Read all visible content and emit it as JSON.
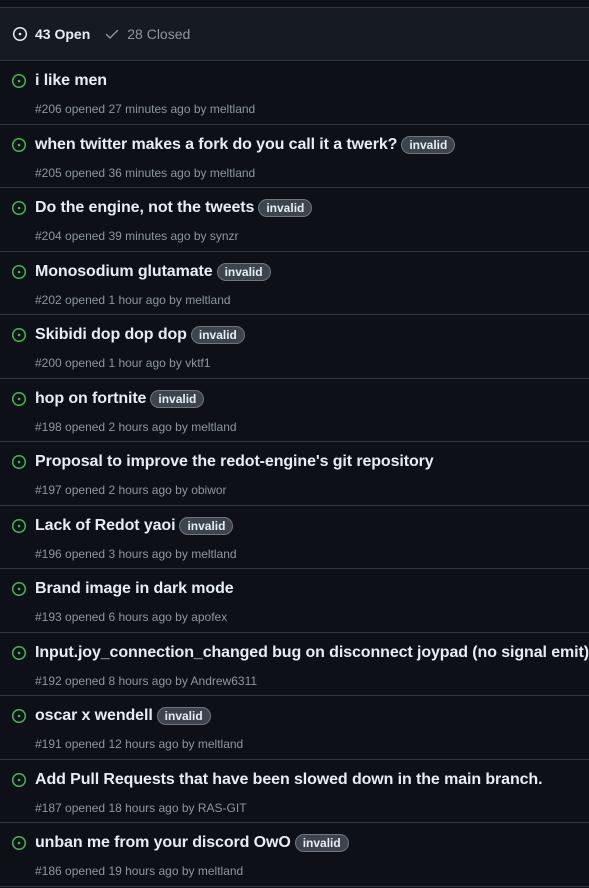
{
  "header": {
    "open_count_label": "43 Open",
    "closed_count_label": "28 Closed"
  },
  "colors": {
    "open_icon": "#3fb950",
    "background": "#0d1117",
    "header_bg": "#161b22",
    "border": "#30363d"
  },
  "issues": [
    {
      "title": "i like men",
      "label": "",
      "number": "#206",
      "time": "27 minutes ago",
      "author": "meltland"
    },
    {
      "title": "when twitter makes a fork do you call it a twerk?",
      "label": "invalid",
      "number": "#205",
      "time": "36 minutes ago",
      "author": "meltland"
    },
    {
      "title": "Do the engine, not the tweets",
      "label": "invalid",
      "number": "#204",
      "time": "39 minutes ago",
      "author": "synzr"
    },
    {
      "title": "Monosodium glutamate",
      "label": "invalid",
      "number": "#202",
      "time": "1 hour ago",
      "author": "meltland"
    },
    {
      "title": "Skibidi dop dop dop",
      "label": "invalid",
      "number": "#200",
      "time": "1 hour ago",
      "author": "vktf1"
    },
    {
      "title": "hop on fortnite",
      "label": "invalid",
      "number": "#198",
      "time": "2 hours ago",
      "author": "meltland"
    },
    {
      "title": "Proposal to improve the redot-engine's git repository",
      "label": "",
      "number": "#197",
      "time": "2 hours ago",
      "author": "obiwor"
    },
    {
      "title": "Lack of Redot yaoi",
      "label": "invalid",
      "number": "#196",
      "time": "3 hours ago",
      "author": "meltland"
    },
    {
      "title": "Brand image in dark mode",
      "label": "",
      "number": "#193",
      "time": "6 hours ago",
      "author": "apofex"
    },
    {
      "title": "Input.joy_connection_changed bug on disconnect joypad (no signal emit)",
      "label": "",
      "number": "#192",
      "time": "8 hours ago",
      "author": "Andrew6311"
    },
    {
      "title": "oscar x wendell",
      "label": "invalid",
      "number": "#191",
      "time": "12 hours ago",
      "author": "meltland"
    },
    {
      "title": "Add Pull Requests that have been slowed down in the main branch.",
      "label": "",
      "number": "#187",
      "time": "18 hours ago",
      "author": "RAS-GIT"
    },
    {
      "title": "unban me from your discord OwO",
      "label": "invalid",
      "number": "#186",
      "time": "19 hours ago",
      "author": "meltland"
    }
  ],
  "strings": {
    "opened": "opened",
    "by": "by"
  }
}
